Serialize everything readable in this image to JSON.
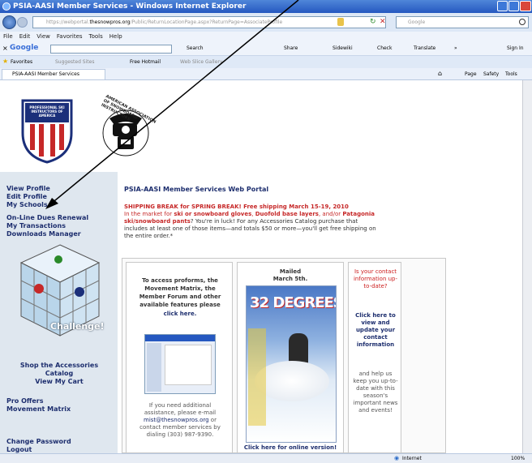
{
  "browser": {
    "title": "PSIA-AASI Member Services - Windows Internet Explorer",
    "url_prefix": "https://webportal.",
    "url_domain": "thesnowpros.org",
    "url_rest": "/Public/ReturnLocationPage.aspx?ReturnPage=AssociateProfile",
    "search_placeholder": "Google",
    "menu": [
      "File",
      "Edit",
      "View",
      "Favorites",
      "Tools",
      "Help"
    ],
    "google_label": "Google",
    "google_buttons": [
      "Search",
      "Share",
      "Sidewiki",
      "Check",
      "Translate",
      "»"
    ],
    "google_signin": "Sign In",
    "favorites_label": "Favorites",
    "favorites": [
      "Suggested Sites",
      "Free Hotmail",
      "Web Slice Gallery"
    ],
    "tab_title": "PSIA-AASI Member Services",
    "tools": [
      "Page",
      "Safety",
      "Tools"
    ],
    "status_zone": "Internet",
    "zoom": "100%"
  },
  "logo": {
    "psia_text": "PROFESSIONAL SKI INSTRUCTORS OF AMERICA",
    "aasi_ring": "AMERICAN ASSOCIATION OF SNOWBOARD INSTRUCTORS"
  },
  "sidebar": {
    "links_group1": [
      "View Profile",
      "Edit Profile",
      "My Schools"
    ],
    "links_group2": [
      "On-Line Dues Renewal",
      "My Transactions",
      "Downloads Manager"
    ],
    "challenge_caption": "Challenge!",
    "shop_label": "Shop the Accessories Catalog",
    "cart_label": "View My Cart",
    "links_group3": [
      "Pro Offers",
      "Movement Matrix"
    ],
    "links_group4": [
      "Change Password",
      "Logout"
    ]
  },
  "main": {
    "heading": "PSIA-AASI Member Services Web Portal",
    "announcement_title": "SHIPPING BREAK for SPRING BREAK! Free shipping March 15-19, 2010",
    "announcement_line2a": "In the market for ",
    "announcement_line2b": "ski or snowboard gloves",
    "announcement_line2c": ", ",
    "announcement_line2d": "Duofold base layers",
    "announcement_line2e": ", and/or ",
    "announcement_line2f": "Patagonia",
    "announcement_line3a": "ski/snowboard pants",
    "announcement_line3b": "? You're in luck! For any Accessories Catalog purchase that",
    "announcement_line4": "includes at least one of those items—and totals $50 or more—you'll get free shipping on",
    "announcement_line5": "the entire order.*"
  },
  "panels": {
    "left": {
      "text1": "To access proforms, the Movement Matrix, the Member Forum and other available features please",
      "click": "click here.",
      "help1": "If you need additional assistance, please e-mail",
      "help_email": "mist@thesnowpros.org",
      "help2": "or contact member services by dialing (303) 987-9390."
    },
    "middle": {
      "mailed": "Mailed",
      "date": "March 5th.",
      "magazine_title": "32 DEGREES",
      "online_link": "Click here for online version!"
    },
    "right": {
      "line1": "Is your contact information up-to-date?",
      "click": "Click here to view and update your contact information",
      "line2": "and help us keep you up-to-date with this season's important news and events!"
    }
  },
  "colors": {
    "sidebar_bg": "#dfe7ef",
    "link_color": "#1d2e6e",
    "alert_red": "#cc1d1d"
  }
}
